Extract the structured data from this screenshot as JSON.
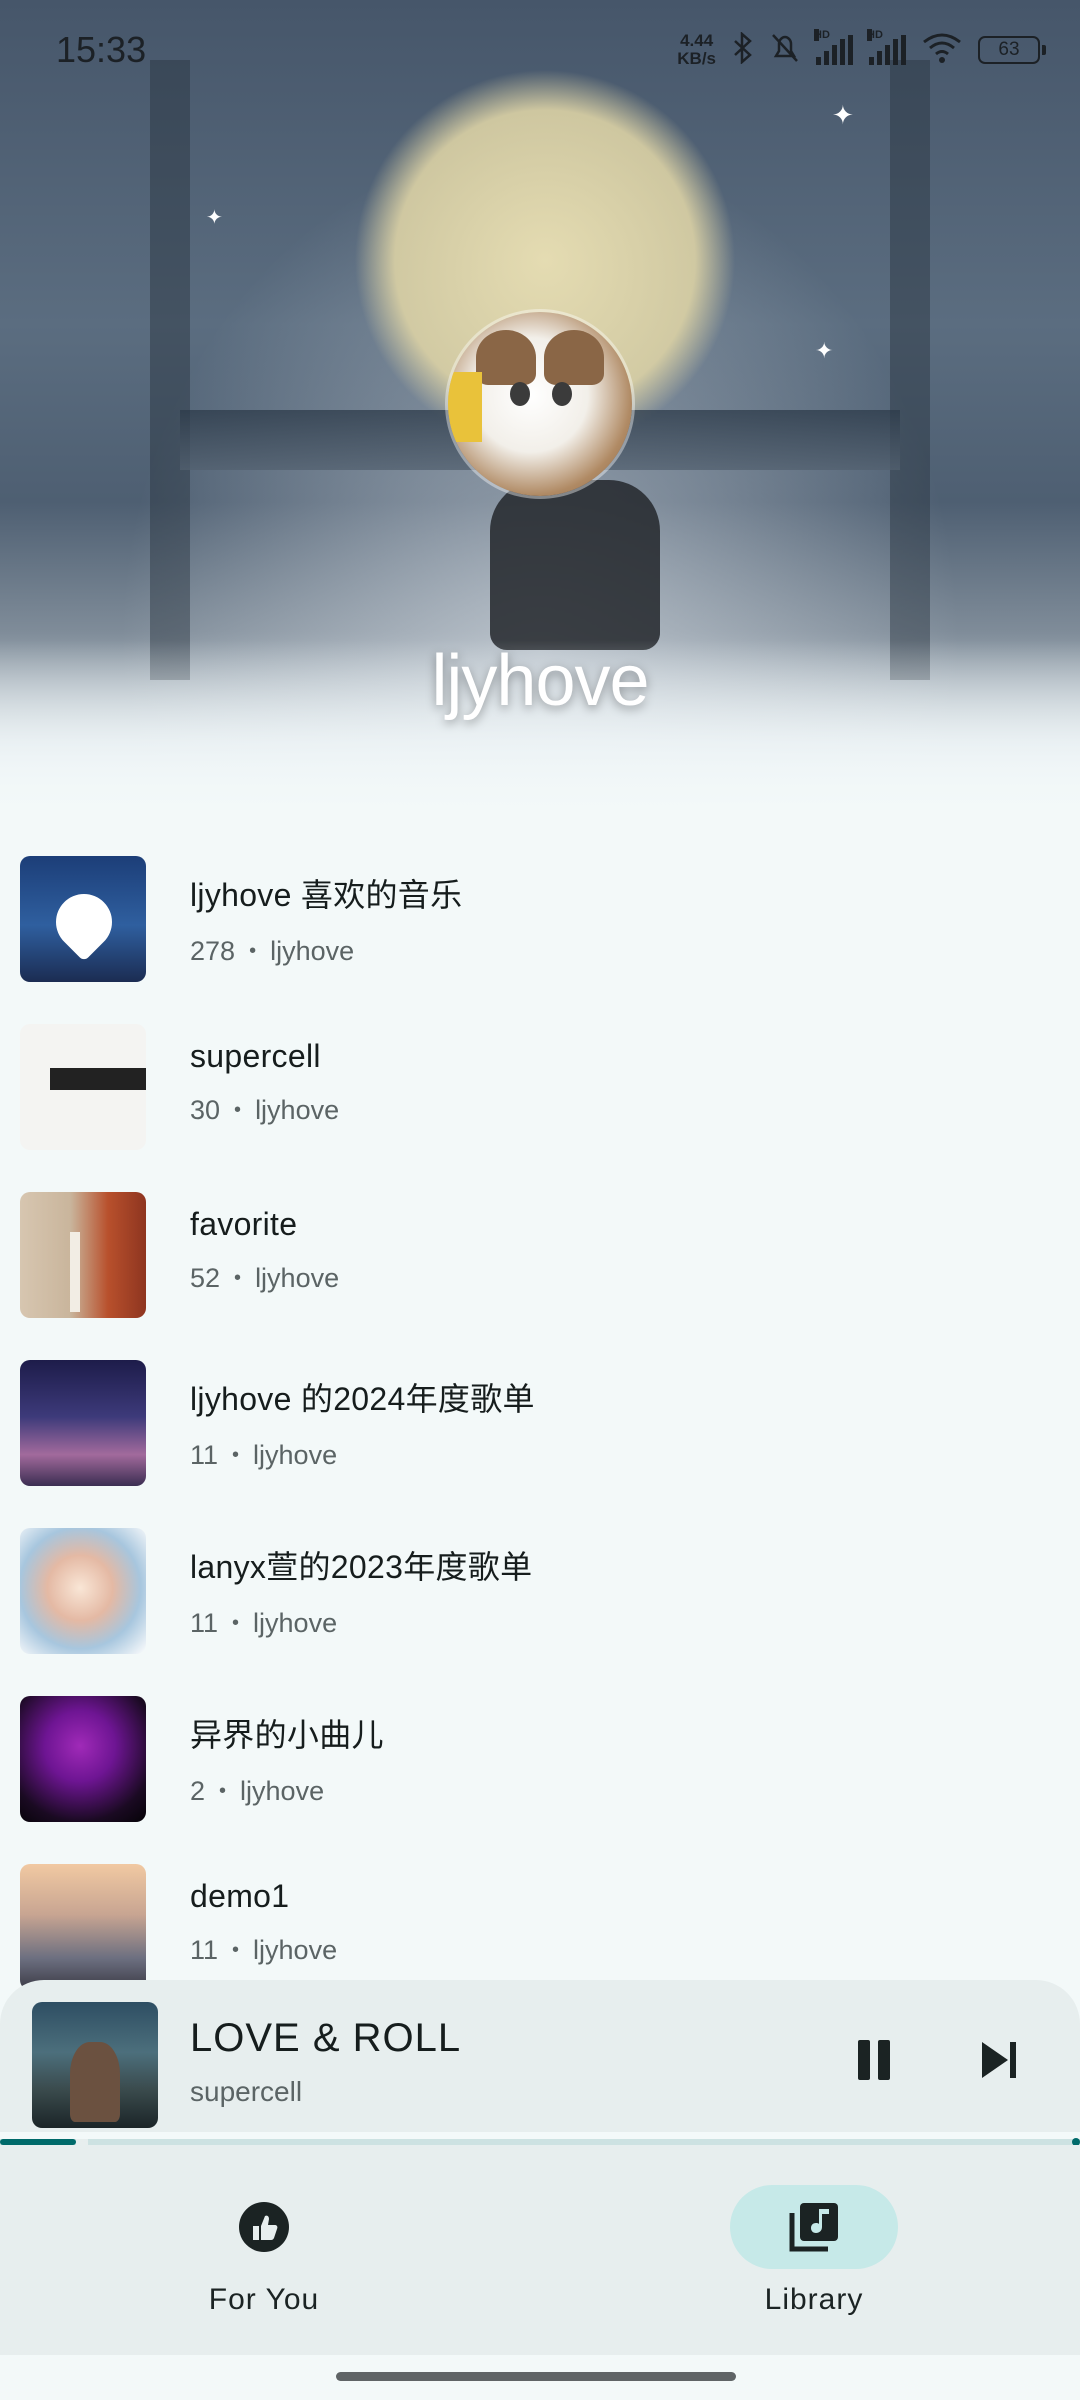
{
  "status_bar": {
    "time": "15:33",
    "net_speed_value": "4.44",
    "net_speed_unit": "KB/s",
    "signal_label_1": "HD",
    "signal_label_2": "HD",
    "battery": "63"
  },
  "profile": {
    "username": "ljyhove"
  },
  "playlists": [
    {
      "title": "ljyhove 喜欢的音乐",
      "count": "278",
      "owner": "ljyhove"
    },
    {
      "title": "supercell",
      "count": "30",
      "owner": "ljyhove"
    },
    {
      "title": "favorite",
      "count": "52",
      "owner": "ljyhove"
    },
    {
      "title": "ljyhove 的2024年度歌单",
      "count": "11",
      "owner": "ljyhove"
    },
    {
      "title": "lanyx萱的2023年度歌单",
      "count": "11",
      "owner": "ljyhove"
    },
    {
      "title": "异界的小曲儿",
      "count": "2",
      "owner": "ljyhove"
    },
    {
      "title": "demo1",
      "count": "11",
      "owner": "ljyhove"
    }
  ],
  "meta_separator": "•",
  "now_playing": {
    "title": "LOVE & ROLL",
    "artist": "supercell",
    "progress": 0.07
  },
  "nav": {
    "items": [
      {
        "label": "For You",
        "icon": "thumb-up-icon",
        "selected": false
      },
      {
        "label": "Library",
        "icon": "library-music-icon",
        "selected": true
      }
    ]
  },
  "colors": {
    "accent": "#006a6a",
    "nav_selected_pill": "#c6e9e8",
    "surface": "#e7eeee",
    "background": "#f3f9f9"
  }
}
